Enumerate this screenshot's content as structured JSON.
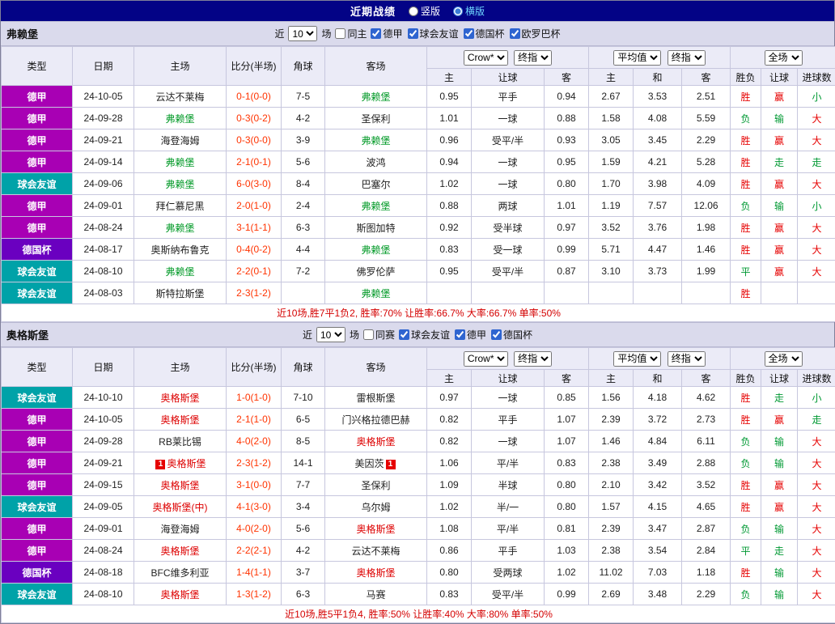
{
  "top": {
    "title": "近期战绩",
    "radios": [
      {
        "label": "竖版",
        "checked": false
      },
      {
        "label": "横版",
        "checked": true
      }
    ]
  },
  "colors": {
    "league": {
      "德甲": "#a800b4",
      "球会友谊": "#00a2a8",
      "德国杯": "#6a00c0"
    },
    "team": {
      "green": "#009926",
      "red": "#dd0000",
      "default": "#222222"
    },
    "result": {
      "red": "#e60000",
      "green": "#009933"
    },
    "score": "#ff3300",
    "summary": "#d40000"
  },
  "sections": [
    {
      "team": "弗赖堡",
      "filter": {
        "near": "近",
        "count": "10",
        "games": "场",
        "same": "同主",
        "leagues": [
          "德甲",
          "球会友谊",
          "德国杯",
          "欧罗巴杯"
        ]
      },
      "header": {
        "base": [
          "类型",
          "日期",
          "主场",
          "比分(半场)",
          "角球",
          "客场"
        ],
        "group1": [
          "Crow*",
          "终指"
        ],
        "group2": [
          "平均值",
          "终指"
        ],
        "group3": [
          "全场"
        ],
        "sub": [
          "主",
          "让球",
          "客",
          "主",
          "和",
          "客",
          "胜负",
          "让球",
          "进球数"
        ]
      },
      "rows": [
        {
          "league": "德甲",
          "date": "24-10-05",
          "home": "云达不莱梅",
          "home_color": "",
          "home_badge": "",
          "score": "0-1(0-0)",
          "corners": "7-5",
          "away": "弗赖堡",
          "away_color": "green",
          "away_badge": "",
          "odds": [
            "0.95",
            "平手",
            "0.94",
            "2.67",
            "3.53",
            "2.51"
          ],
          "results": [
            {
              "text": "胜",
              "color": "red"
            },
            {
              "text": "赢",
              "color": "red"
            },
            {
              "text": "小",
              "color": "green"
            }
          ]
        },
        {
          "league": "德甲",
          "date": "24-09-28",
          "home": "弗赖堡",
          "home_color": "green",
          "home_badge": "",
          "score": "0-3(0-2)",
          "corners": "4-2",
          "away": "圣保利",
          "away_color": "",
          "away_badge": "",
          "odds": [
            "1.01",
            "一球",
            "0.88",
            "1.58",
            "4.08",
            "5.59"
          ],
          "results": [
            {
              "text": "负",
              "color": "green"
            },
            {
              "text": "输",
              "color": "green"
            },
            {
              "text": "大",
              "color": "red"
            }
          ]
        },
        {
          "league": "德甲",
          "date": "24-09-21",
          "home": "海登海姆",
          "home_color": "",
          "home_badge": "",
          "score": "0-3(0-0)",
          "corners": "3-9",
          "away": "弗赖堡",
          "away_color": "green",
          "away_badge": "",
          "odds": [
            "0.96",
            "受平/半",
            "0.93",
            "3.05",
            "3.45",
            "2.29"
          ],
          "results": [
            {
              "text": "胜",
              "color": "red"
            },
            {
              "text": "赢",
              "color": "red"
            },
            {
              "text": "大",
              "color": "red"
            }
          ]
        },
        {
          "league": "德甲",
          "date": "24-09-14",
          "home": "弗赖堡",
          "home_color": "green",
          "home_badge": "",
          "score": "2-1(0-1)",
          "corners": "5-6",
          "away": "波鸿",
          "away_color": "",
          "away_badge": "",
          "odds": [
            "0.94",
            "一球",
            "0.95",
            "1.59",
            "4.21",
            "5.28"
          ],
          "results": [
            {
              "text": "胜",
              "color": "red"
            },
            {
              "text": "走",
              "color": "green"
            },
            {
              "text": "走",
              "color": "green"
            }
          ]
        },
        {
          "league": "球会友谊",
          "date": "24-09-06",
          "home": "弗赖堡",
          "home_color": "green",
          "home_badge": "",
          "score": "6-0(3-0)",
          "corners": "8-4",
          "away": "巴塞尔",
          "away_color": "",
          "away_badge": "",
          "odds": [
            "1.02",
            "一球",
            "0.80",
            "1.70",
            "3.98",
            "4.09"
          ],
          "results": [
            {
              "text": "胜",
              "color": "red"
            },
            {
              "text": "赢",
              "color": "red"
            },
            {
              "text": "大",
              "color": "red"
            }
          ]
        },
        {
          "league": "德甲",
          "date": "24-09-01",
          "home": "拜仁慕尼黑",
          "home_color": "",
          "home_badge": "",
          "score": "2-0(1-0)",
          "corners": "2-4",
          "away": "弗赖堡",
          "away_color": "green",
          "away_badge": "",
          "odds": [
            "0.88",
            "两球",
            "1.01",
            "1.19",
            "7.57",
            "12.06"
          ],
          "results": [
            {
              "text": "负",
              "color": "green"
            },
            {
              "text": "输",
              "color": "green"
            },
            {
              "text": "小",
              "color": "green"
            }
          ]
        },
        {
          "league": "德甲",
          "date": "24-08-24",
          "home": "弗赖堡",
          "home_color": "green",
          "home_badge": "",
          "score": "3-1(1-1)",
          "corners": "6-3",
          "away": "斯图加特",
          "away_color": "",
          "away_badge": "",
          "odds": [
            "0.92",
            "受半球",
            "0.97",
            "3.52",
            "3.76",
            "1.98"
          ],
          "results": [
            {
              "text": "胜",
              "color": "red"
            },
            {
              "text": "赢",
              "color": "red"
            },
            {
              "text": "大",
              "color": "red"
            }
          ]
        },
        {
          "league": "德国杯",
          "date": "24-08-17",
          "home": "奥斯纳布鲁克",
          "home_color": "",
          "home_badge": "",
          "score": "0-4(0-2)",
          "corners": "4-4",
          "away": "弗赖堡",
          "away_color": "green",
          "away_badge": "",
          "odds": [
            "0.83",
            "受一球",
            "0.99",
            "5.71",
            "4.47",
            "1.46"
          ],
          "results": [
            {
              "text": "胜",
              "color": "red"
            },
            {
              "text": "赢",
              "color": "red"
            },
            {
              "text": "大",
              "color": "red"
            }
          ]
        },
        {
          "league": "球会友谊",
          "date": "24-08-10",
          "home": "弗赖堡",
          "home_color": "green",
          "home_badge": "",
          "score": "2-2(0-1)",
          "corners": "7-2",
          "away": "佛罗伦萨",
          "away_color": "",
          "away_badge": "",
          "odds": [
            "0.95",
            "受平/半",
            "0.87",
            "3.10",
            "3.73",
            "1.99"
          ],
          "results": [
            {
              "text": "平",
              "color": "green"
            },
            {
              "text": "赢",
              "color": "red"
            },
            {
              "text": "大",
              "color": "red"
            }
          ]
        },
        {
          "league": "球会友谊",
          "date": "24-08-03",
          "home": "斯特拉斯堡",
          "home_color": "",
          "home_badge": "",
          "score": "2-3(1-2)",
          "corners": "",
          "away": "弗赖堡",
          "away_color": "green",
          "away_badge": "",
          "odds": [
            "",
            "",
            "",
            "",
            "",
            ""
          ],
          "results": [
            {
              "text": "胜",
              "color": "red"
            },
            {
              "text": "",
              "color": ""
            },
            {
              "text": "",
              "color": ""
            }
          ]
        }
      ],
      "summary": "近10场,胜7平1负2, 胜率:70% 让胜率:66.7% 大率:66.7% 单率:50%"
    },
    {
      "team": "奥格斯堡",
      "filter": {
        "near": "近",
        "count": "10",
        "games": "场",
        "same": "同赛",
        "leagues": [
          "球会友谊",
          "德甲",
          "德国杯"
        ]
      },
      "header": {
        "base": [
          "类型",
          "日期",
          "主场",
          "比分(半场)",
          "角球",
          "客场"
        ],
        "group1": [
          "Crow*",
          "终指"
        ],
        "group2": [
          "平均值",
          "终指"
        ],
        "group3": [
          "全场"
        ],
        "sub": [
          "主",
          "让球",
          "客",
          "主",
          "和",
          "客",
          "胜负",
          "让球",
          "进球数"
        ]
      },
      "rows": [
        {
          "league": "球会友谊",
          "date": "24-10-10",
          "home": "奥格斯堡",
          "home_color": "red",
          "home_badge": "",
          "score": "1-0(1-0)",
          "corners": "7-10",
          "away": "雷根斯堡",
          "away_color": "",
          "away_badge": "",
          "odds": [
            "0.97",
            "一球",
            "0.85",
            "1.56",
            "4.18",
            "4.62"
          ],
          "results": [
            {
              "text": "胜",
              "color": "red"
            },
            {
              "text": "走",
              "color": "green"
            },
            {
              "text": "小",
              "color": "green"
            }
          ]
        },
        {
          "league": "德甲",
          "date": "24-10-05",
          "home": "奥格斯堡",
          "home_color": "red",
          "home_badge": "",
          "score": "2-1(1-0)",
          "corners": "6-5",
          "away": "门兴格拉德巴赫",
          "away_color": "",
          "away_badge": "",
          "odds": [
            "0.82",
            "平手",
            "1.07",
            "2.39",
            "3.72",
            "2.73"
          ],
          "results": [
            {
              "text": "胜",
              "color": "red"
            },
            {
              "text": "赢",
              "color": "red"
            },
            {
              "text": "走",
              "color": "green"
            }
          ]
        },
        {
          "league": "德甲",
          "date": "24-09-28",
          "home": "RB莱比锡",
          "home_color": "",
          "home_badge": "",
          "score": "4-0(2-0)",
          "corners": "8-5",
          "away": "奥格斯堡",
          "away_color": "red",
          "away_badge": "",
          "odds": [
            "0.82",
            "一球",
            "1.07",
            "1.46",
            "4.84",
            "6.11"
          ],
          "results": [
            {
              "text": "负",
              "color": "green"
            },
            {
              "text": "输",
              "color": "green"
            },
            {
              "text": "大",
              "color": "red"
            }
          ]
        },
        {
          "league": "德甲",
          "date": "24-09-21",
          "home": "奥格斯堡",
          "home_color": "red",
          "home_badge": "1",
          "score": "2-3(1-2)",
          "corners": "14-1",
          "away": "美因茨",
          "away_color": "",
          "away_badge": "1",
          "odds": [
            "1.06",
            "平/半",
            "0.83",
            "2.38",
            "3.49",
            "2.88"
          ],
          "results": [
            {
              "text": "负",
              "color": "green"
            },
            {
              "text": "输",
              "color": "green"
            },
            {
              "text": "大",
              "color": "red"
            }
          ]
        },
        {
          "league": "德甲",
          "date": "24-09-15",
          "home": "奥格斯堡",
          "home_color": "red",
          "home_badge": "",
          "score": "3-1(0-0)",
          "corners": "7-7",
          "away": "圣保利",
          "away_color": "",
          "away_badge": "",
          "odds": [
            "1.09",
            "半球",
            "0.80",
            "2.10",
            "3.42",
            "3.52"
          ],
          "results": [
            {
              "text": "胜",
              "color": "red"
            },
            {
              "text": "赢",
              "color": "red"
            },
            {
              "text": "大",
              "color": "red"
            }
          ]
        },
        {
          "league": "球会友谊",
          "date": "24-09-05",
          "home": "奥格斯堡(中)",
          "home_color": "red",
          "home_badge": "",
          "score": "4-1(3-0)",
          "corners": "3-4",
          "away": "乌尔姆",
          "away_color": "",
          "away_badge": "",
          "odds": [
            "1.02",
            "半/一",
            "0.80",
            "1.57",
            "4.15",
            "4.65"
          ],
          "results": [
            {
              "text": "胜",
              "color": "red"
            },
            {
              "text": "赢",
              "color": "red"
            },
            {
              "text": "大",
              "color": "red"
            }
          ]
        },
        {
          "league": "德甲",
          "date": "24-09-01",
          "home": "海登海姆",
          "home_color": "",
          "home_badge": "",
          "score": "4-0(2-0)",
          "corners": "5-6",
          "away": "奥格斯堡",
          "away_color": "red",
          "away_badge": "",
          "odds": [
            "1.08",
            "平/半",
            "0.81",
            "2.39",
            "3.47",
            "2.87"
          ],
          "results": [
            {
              "text": "负",
              "color": "green"
            },
            {
              "text": "输",
              "color": "green"
            },
            {
              "text": "大",
              "color": "red"
            }
          ]
        },
        {
          "league": "德甲",
          "date": "24-08-24",
          "home": "奥格斯堡",
          "home_color": "red",
          "home_badge": "",
          "score": "2-2(2-1)",
          "corners": "4-2",
          "away": "云达不莱梅",
          "away_color": "",
          "away_badge": "",
          "odds": [
            "0.86",
            "平手",
            "1.03",
            "2.38",
            "3.54",
            "2.84"
          ],
          "results": [
            {
              "text": "平",
              "color": "green"
            },
            {
              "text": "走",
              "color": "green"
            },
            {
              "text": "大",
              "color": "red"
            }
          ]
        },
        {
          "league": "德国杯",
          "date": "24-08-18",
          "home": "BFC维多利亚",
          "home_color": "",
          "home_badge": "",
          "score": "1-4(1-1)",
          "corners": "3-7",
          "away": "奥格斯堡",
          "away_color": "red",
          "away_badge": "",
          "odds": [
            "0.80",
            "受两球",
            "1.02",
            "11.02",
            "7.03",
            "1.18"
          ],
          "results": [
            {
              "text": "胜",
              "color": "red"
            },
            {
              "text": "输",
              "color": "green"
            },
            {
              "text": "大",
              "color": "red"
            }
          ]
        },
        {
          "league": "球会友谊",
          "date": "24-08-10",
          "home": "奥格斯堡",
          "home_color": "red",
          "home_badge": "",
          "score": "1-3(1-2)",
          "corners": "6-3",
          "away": "马赛",
          "away_color": "",
          "away_badge": "",
          "odds": [
            "0.83",
            "受平/半",
            "0.99",
            "2.69",
            "3.48",
            "2.29"
          ],
          "results": [
            {
              "text": "负",
              "color": "green"
            },
            {
              "text": "输",
              "color": "green"
            },
            {
              "text": "大",
              "color": "red"
            }
          ]
        }
      ],
      "summary": "近10场,胜5平1负4, 胜率:50% 让胜率:40% 大率:80% 单率:50%"
    }
  ]
}
